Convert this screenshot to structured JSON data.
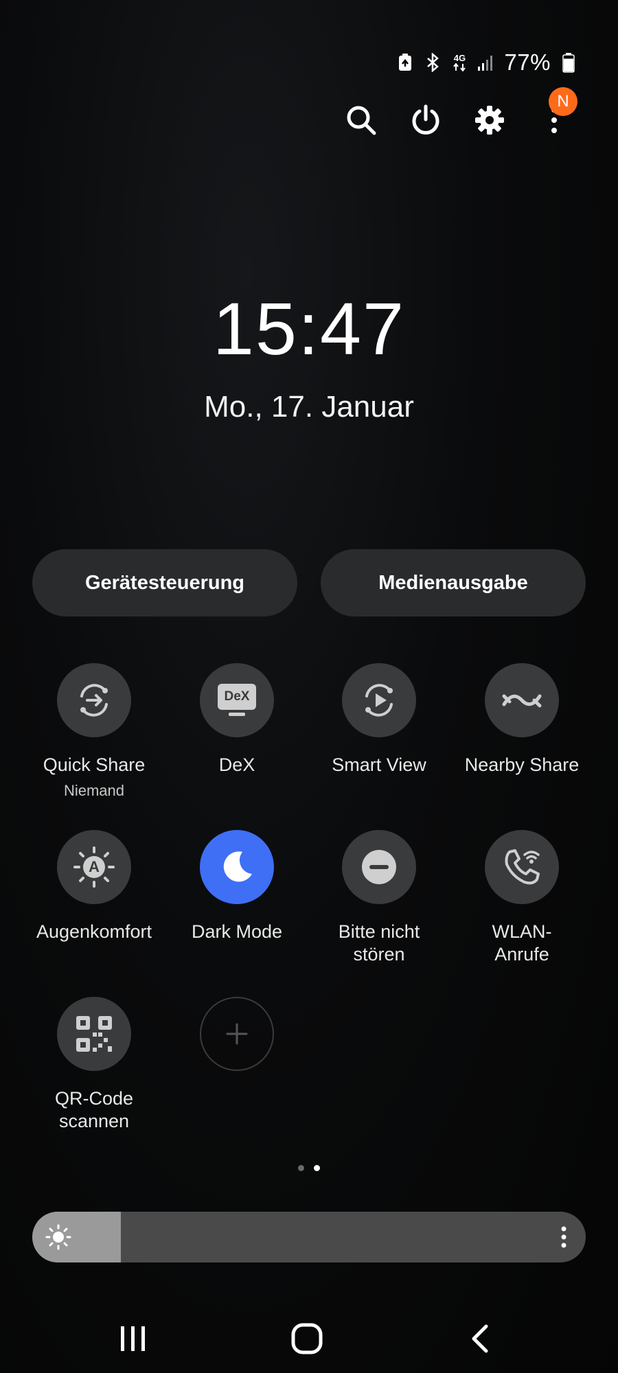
{
  "status_bar": {
    "icons": [
      "battery-saver-icon",
      "bluetooth-icon",
      "4g-data-icon",
      "signal-icon",
      "battery-icon"
    ],
    "network_label": "4G",
    "battery_percent": "77%",
    "battery_level": 0.77
  },
  "top_actions": {
    "icons": [
      "search-icon",
      "power-icon",
      "gear-icon",
      "more-vertical-icon"
    ],
    "notification_badge": "N",
    "badge_color": "#ff6a1a"
  },
  "clock": {
    "time": "15:47",
    "date": "Mo., 17. Januar"
  },
  "buttons": {
    "device_control": "Gerätesteuerung",
    "media_output": "Medienausgabe"
  },
  "tiles": [
    {
      "label": "Quick Share",
      "sub": "Niemand",
      "icon": "quick-share-icon",
      "active": false
    },
    {
      "label": "DeX",
      "icon": "dex-icon",
      "icon_text": "DeX",
      "active": false
    },
    {
      "label": "Smart View",
      "icon": "smart-view-icon",
      "active": false
    },
    {
      "label": "Nearby Share",
      "icon": "nearby-share-icon",
      "active": false
    },
    {
      "label": "Augenkomfort",
      "icon": "eye-comfort-icon",
      "icon_text": "A",
      "active": false
    },
    {
      "label": "Dark Mode",
      "icon": "moon-icon",
      "active": true
    },
    {
      "label": "Bitte nicht stören",
      "icon": "do-not-disturb-icon",
      "active": false
    },
    {
      "label": "WLAN-Anrufe",
      "icon": "wifi-calling-icon",
      "active": false
    },
    {
      "label": "QR-Code scannen",
      "icon": "qr-code-icon",
      "active": false
    },
    {
      "label": "",
      "icon": "add-icon",
      "active": false
    }
  ],
  "page_indicator": {
    "pages": 2,
    "current": 2
  },
  "brightness": {
    "level": 0.16,
    "icons": [
      "sun-icon",
      "more-vertical-icon"
    ]
  },
  "nav_bar": {
    "icons": [
      "recents-icon",
      "home-icon",
      "back-icon"
    ]
  },
  "colors": {
    "accent": "#3e6ff5",
    "tile_bg": "#3a3b3d",
    "pill_bg": "#2a2b2d"
  }
}
